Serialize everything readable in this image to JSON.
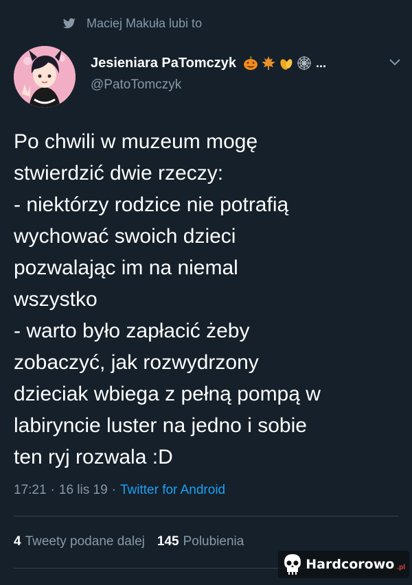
{
  "liked_by": {
    "text": "Maciej Makuła lubi to",
    "icon": "twitter-bird-icon"
  },
  "author": {
    "display_name": "Jesieniara PaTomczyk",
    "emojis": [
      "jack-o-lantern",
      "maple-leaf",
      "fallen-leaves",
      "spider-web"
    ],
    "more": "...",
    "handle": "@PatoTomczyk"
  },
  "tweet": {
    "text": "Po chwili w muzeum mogę\nstwierdzić dwie rzeczy:\n- niektórzy rodzice nie potrafią\nwychować swoich dzieci\npozwalając im na niemal\nwszystko\n- warto było zapłacić żeby\nzobaczyć, jak rozwydrzony\ndzieciak wbiega z pełną pompą w\nlabiryncie luster na jedno i sobie\nten ryj rozwala :D"
  },
  "meta": {
    "time": "17:21",
    "date": "16 lis 19",
    "separator": "·",
    "source": "Twitter for Android"
  },
  "stats": {
    "retweets_count": "4",
    "retweets_label": "Tweety podane dalej",
    "likes_count": "145",
    "likes_label": "Polubienia"
  },
  "watermark": {
    "brand": "Hardcorowo",
    "tld": ".pl"
  },
  "colors": {
    "background": "#15202b",
    "secondary_text": "#8899a6",
    "link": "#1da1f2",
    "divider": "#38444d"
  }
}
